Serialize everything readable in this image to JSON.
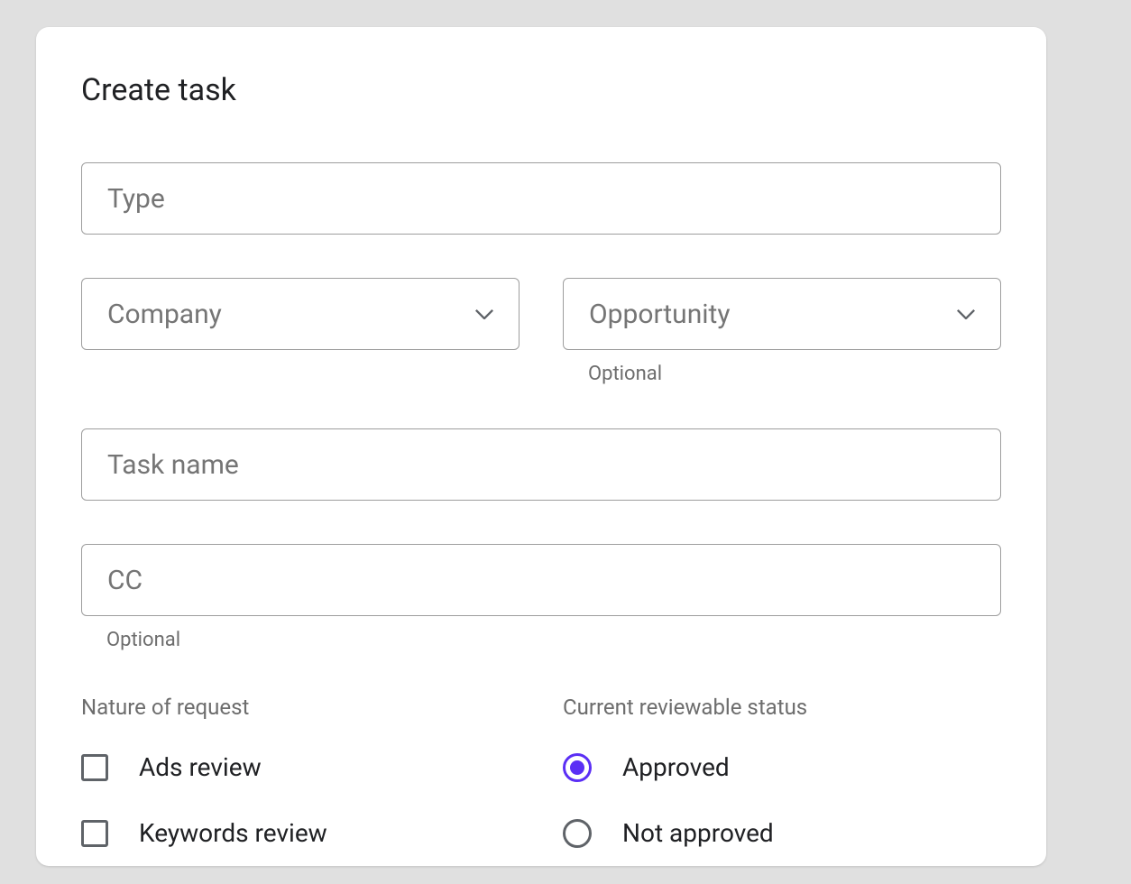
{
  "card": {
    "title": "Create task",
    "fields": {
      "type": {
        "label": "Type"
      },
      "company": {
        "label": "Company"
      },
      "opportunity": {
        "label": "Opportunity",
        "helper": "Optional"
      },
      "taskName": {
        "label": "Task name"
      },
      "cc": {
        "label": "CC",
        "helper": "Optional"
      }
    },
    "natureOfRequest": {
      "label": "Nature of request",
      "options": [
        {
          "label": "Ads review",
          "checked": false
        },
        {
          "label": "Keywords review",
          "checked": false
        }
      ]
    },
    "reviewableStatus": {
      "label": "Current reviewable status",
      "options": [
        {
          "label": "Approved",
          "selected": true
        },
        {
          "label": "Not approved",
          "selected": false
        }
      ]
    }
  }
}
